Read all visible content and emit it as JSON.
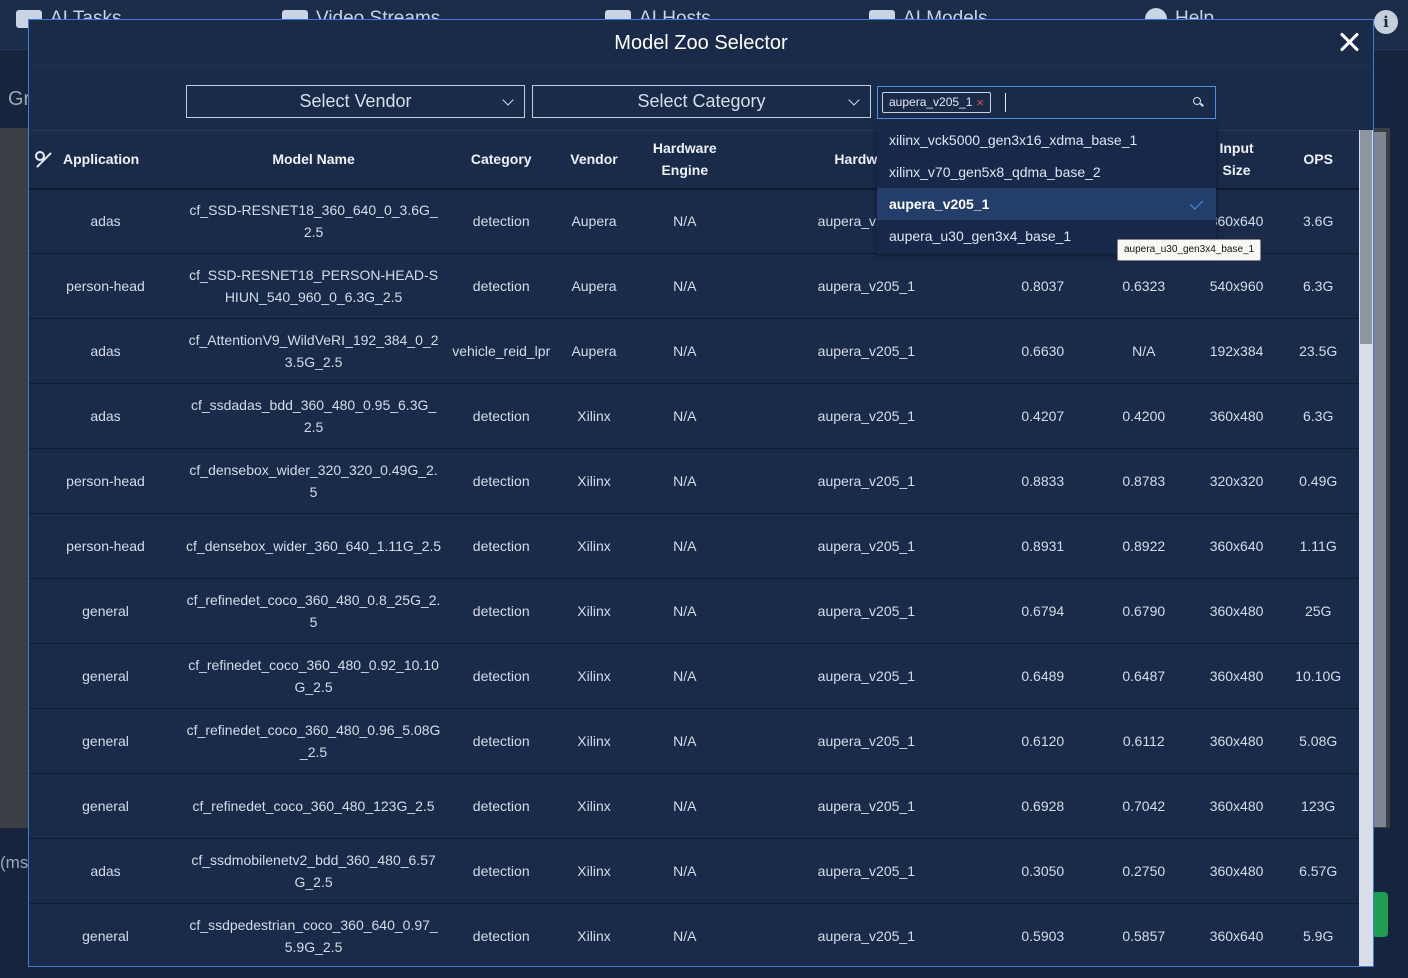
{
  "background": {
    "nav_items": [
      {
        "label": "AI Tasks",
        "icon": "tasks-icon"
      },
      {
        "label": "Video Streams",
        "icon": "video-icon"
      },
      {
        "label": "AI Hosts",
        "icon": "hosts-icon"
      },
      {
        "label": "AI Models",
        "icon": "models-icon"
      },
      {
        "label": "Help",
        "icon": "help-icon"
      }
    ],
    "left_text_1": "Gr",
    "left_text_2": "(ms",
    "info_icon": "i"
  },
  "modal": {
    "title": "Model Zoo Selector"
  },
  "filters": {
    "vendor_select": "Select Vendor",
    "category_select": "Select Category",
    "hardware_tag": "aupera_v205_1",
    "tag_remove": "×"
  },
  "table": {
    "columns": [
      "Application",
      "Model Name",
      "Category",
      "Vendor",
      "Hardware Engine",
      "Hardware",
      "",
      "",
      "Input Size",
      "OPS"
    ],
    "rows": [
      {
        "app": "adas",
        "model": "cf_SSD-RESNET18_360_640_0_3.6G_2.5",
        "category": "detection",
        "vendor": "Aupera",
        "engine": "N/A",
        "hardware": "aupera_v205_1",
        "m1": "",
        "m2": "",
        "input": "360x640",
        "ops": "3.6G"
      },
      {
        "app": "person-head",
        "model": "cf_SSD-RESNET18_PERSON-HEAD-SHIUN_540_960_0_6.3G_2.5",
        "category": "detection",
        "vendor": "Aupera",
        "engine": "N/A",
        "hardware": "aupera_v205_1",
        "m1": "0.8037",
        "m2": "0.6323",
        "input": "540x960",
        "ops": "6.3G"
      },
      {
        "app": "adas",
        "model": "cf_AttentionV9_WildVeRI_192_384_0_23.5G_2.5",
        "category": "vehicle_reid_lpr",
        "vendor": "Aupera",
        "engine": "N/A",
        "hardware": "aupera_v205_1",
        "m1": "0.6630",
        "m2": "N/A",
        "input": "192x384",
        "ops": "23.5G"
      },
      {
        "app": "adas",
        "model": "cf_ssdadas_bdd_360_480_0.95_6.3G_2.5",
        "category": "detection",
        "vendor": "Xilinx",
        "engine": "N/A",
        "hardware": "aupera_v205_1",
        "m1": "0.4207",
        "m2": "0.4200",
        "input": "360x480",
        "ops": "6.3G"
      },
      {
        "app": "person-head",
        "model": "cf_densebox_wider_320_320_0.49G_2.5",
        "category": "detection",
        "vendor": "Xilinx",
        "engine": "N/A",
        "hardware": "aupera_v205_1",
        "m1": "0.8833",
        "m2": "0.8783",
        "input": "320x320",
        "ops": "0.49G"
      },
      {
        "app": "person-head",
        "model": "cf_densebox_wider_360_640_1.11G_2.5",
        "category": "detection",
        "vendor": "Xilinx",
        "engine": "N/A",
        "hardware": "aupera_v205_1",
        "m1": "0.8931",
        "m2": "0.8922",
        "input": "360x640",
        "ops": "1.11G"
      },
      {
        "app": "general",
        "model": "cf_refinedet_coco_360_480_0.8_25G_2.5",
        "category": "detection",
        "vendor": "Xilinx",
        "engine": "N/A",
        "hardware": "aupera_v205_1",
        "m1": "0.6794",
        "m2": "0.6790",
        "input": "360x480",
        "ops": "25G"
      },
      {
        "app": "general",
        "model": "cf_refinedet_coco_360_480_0.92_10.10G_2.5",
        "category": "detection",
        "vendor": "Xilinx",
        "engine": "N/A",
        "hardware": "aupera_v205_1",
        "m1": "0.6489",
        "m2": "0.6487",
        "input": "360x480",
        "ops": "10.10G"
      },
      {
        "app": "general",
        "model": "cf_refinedet_coco_360_480_0.96_5.08G_2.5",
        "category": "detection",
        "vendor": "Xilinx",
        "engine": "N/A",
        "hardware": "aupera_v205_1",
        "m1": "0.6120",
        "m2": "0.6112",
        "input": "360x480",
        "ops": "5.08G"
      },
      {
        "app": "general",
        "model": "cf_refinedet_coco_360_480_123G_2.5",
        "category": "detection",
        "vendor": "Xilinx",
        "engine": "N/A",
        "hardware": "aupera_v205_1",
        "m1": "0.6928",
        "m2": "0.7042",
        "input": "360x480",
        "ops": "123G"
      },
      {
        "app": "adas",
        "model": "cf_ssdmobilenetv2_bdd_360_480_6.57G_2.5",
        "category": "detection",
        "vendor": "Xilinx",
        "engine": "N/A",
        "hardware": "aupera_v205_1",
        "m1": "0.3050",
        "m2": "0.2750",
        "input": "360x480",
        "ops": "6.57G"
      },
      {
        "app": "general",
        "model": "cf_ssdpedestrian_coco_360_640_0.97_5.9G_2.5",
        "category": "detection",
        "vendor": "Xilinx",
        "engine": "N/A",
        "hardware": "aupera_v205_1",
        "m1": "0.5903",
        "m2": "0.5857",
        "input": "360x640",
        "ops": "5.9G"
      }
    ]
  },
  "dropdown": {
    "options": [
      {
        "label": "xilinx_vck5000_gen3x16_xdma_base_1",
        "selected": false
      },
      {
        "label": "xilinx_v70_gen5x8_qdma_base_2",
        "selected": false
      },
      {
        "label": "aupera_v205_1",
        "selected": true
      },
      {
        "label": "aupera_u30_gen3x4_base_1",
        "selected": false
      }
    ],
    "tooltip": "aupera_u30_gen3x4_base_1"
  },
  "colors": {
    "accent": "#4b8fe6",
    "modal_bg": "#1a2b4a",
    "remove_x": "#e14b4b",
    "success": "#1e9e52"
  }
}
